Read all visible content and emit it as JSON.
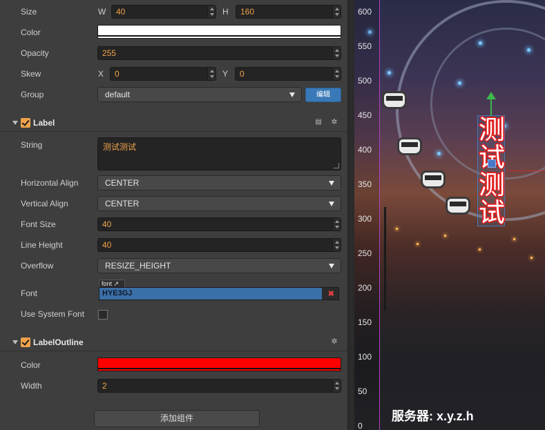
{
  "inspector": {
    "size": {
      "label": "Size",
      "w_label": "W",
      "w_value": "40",
      "h_label": "H",
      "h_value": "160"
    },
    "color": {
      "label": "Color",
      "value": "#ffffff"
    },
    "opacity": {
      "label": "Opacity",
      "value": "255"
    },
    "skew": {
      "label": "Skew",
      "x_label": "X",
      "x_value": "0",
      "y_label": "Y",
      "y_value": "0"
    },
    "group": {
      "label": "Group",
      "value": "default",
      "edit_button": "编辑"
    },
    "label_component": {
      "title": "Label",
      "string": {
        "label": "String",
        "value": "测试测试"
      },
      "horizontal_align": {
        "label": "Horizontal Align",
        "value": "CENTER"
      },
      "vertical_align": {
        "label": "Vertical Align",
        "value": "CENTER"
      },
      "font_size": {
        "label": "Font Size",
        "value": "40"
      },
      "line_height": {
        "label": "Line Height",
        "value": "40"
      },
      "overflow": {
        "label": "Overflow",
        "value": "RESIZE_HEIGHT"
      },
      "font": {
        "label": "Font",
        "tag": "font",
        "value": "HYE3GJ"
      },
      "use_system_font": {
        "label": "Use System Font",
        "checked": false
      }
    },
    "outline_component": {
      "title": "LabelOutline",
      "color": {
        "label": "Color",
        "value": "#ff0000"
      },
      "width": {
        "label": "Width",
        "value": "2"
      }
    },
    "add_component_button": "添加组件"
  },
  "scene": {
    "ruler_ticks": [
      "600",
      "550",
      "500",
      "450",
      "400",
      "350",
      "300",
      "250",
      "200",
      "150",
      "100",
      "50",
      "0"
    ],
    "label_text": "测试测试",
    "server_text": "服务器: x.y.z.h"
  },
  "colors": {
    "accent": "#f0a24a",
    "edit_button": "#3a79b8",
    "outline": "#ff0000"
  }
}
